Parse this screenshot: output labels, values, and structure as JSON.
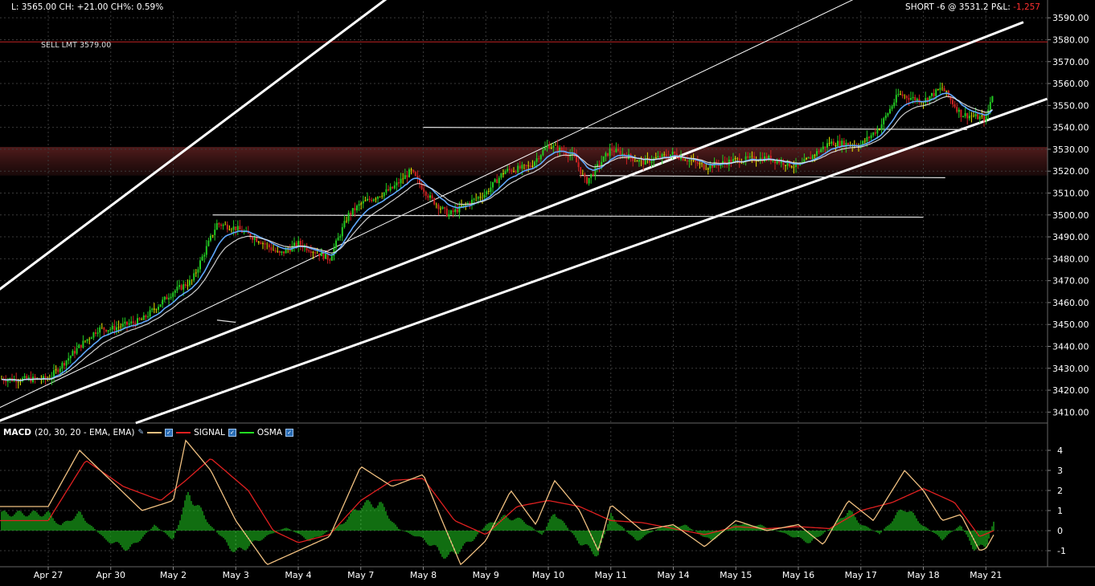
{
  "header": {
    "quote": "L: 3565.00 CH: +21.00 CH%: 0.59%",
    "position": "SHORT -6 @ 3531.2 P&L:",
    "pnl": "-1,257"
  },
  "order": {
    "label": "SELL LMT 3579.00",
    "price": 3579.0
  },
  "colors": {
    "background": "#000000",
    "grid": "#3a3a3a",
    "up_bar": "#22cc22",
    "down_bar": "#cc2222",
    "doji_bar": "#e8e800",
    "ema_fast": "#5fa8ff",
    "ema_slow": "#f0f0f0",
    "channel": "#ffffff",
    "order_line": "#b02020",
    "zone": "#5a1f1f",
    "macd": "#f0c080",
    "signal": "#e02020",
    "osma": "#22dd22"
  },
  "macd_legend": {
    "title": "MACD",
    "params": "(20, 30, 20 - EMA, EMA)",
    "series": [
      {
        "name": "",
        "color": "#f0c080"
      },
      {
        "name": "SIGNAL",
        "color": "#e02020"
      },
      {
        "name": "OSMA",
        "color": "#22dd22"
      }
    ]
  },
  "chart_data": [
    {
      "type": "candlestick",
      "x_labels": [
        "Apr 27",
        "Apr 30",
        "May 2",
        "May 3",
        "May 4",
        "May 7",
        "May 8",
        "May 9",
        "May 10",
        "May 11",
        "May 14",
        "May 15",
        "May 16",
        "May 17",
        "May 18",
        "May 21"
      ],
      "y_ticks": [
        3410,
        3420,
        3430,
        3440,
        3450,
        3460,
        3470,
        3480,
        3490,
        3500,
        3510,
        3520,
        3530,
        3540,
        3550,
        3560,
        3570,
        3580,
        3590
      ],
      "ylim": [
        3405,
        3593
      ],
      "grid": true,
      "price_path": [
        {
          "t": 0.0,
          "y": 3425
        },
        {
          "t": 0.5,
          "y": 3440
        },
        {
          "t": 0.8,
          "y": 3448
        },
        {
          "t": 1.0,
          "y": 3448
        },
        {
          "t": 1.5,
          "y": 3452
        },
        {
          "t": 2.0,
          "y": 3465
        },
        {
          "t": 2.3,
          "y": 3470
        },
        {
          "t": 2.7,
          "y": 3496
        },
        {
          "t": 3.0,
          "y": 3494
        },
        {
          "t": 3.4,
          "y": 3488
        },
        {
          "t": 3.7,
          "y": 3482
        },
        {
          "t": 4.0,
          "y": 3487
        },
        {
          "t": 4.5,
          "y": 3480
        },
        {
          "t": 4.8,
          "y": 3500
        },
        {
          "t": 5.0,
          "y": 3505
        },
        {
          "t": 5.5,
          "y": 3512
        },
        {
          "t": 5.8,
          "y": 3520
        },
        {
          "t": 6.1,
          "y": 3508
        },
        {
          "t": 6.4,
          "y": 3500
        },
        {
          "t": 6.7,
          "y": 3505
        },
        {
          "t": 7.0,
          "y": 3510
        },
        {
          "t": 7.3,
          "y": 3520
        },
        {
          "t": 7.7,
          "y": 3522
        },
        {
          "t": 8.0,
          "y": 3532
        },
        {
          "t": 8.4,
          "y": 3527
        },
        {
          "t": 8.6,
          "y": 3515
        },
        {
          "t": 9.0,
          "y": 3530
        },
        {
          "t": 9.5,
          "y": 3524
        },
        {
          "t": 10.0,
          "y": 3528
        },
        {
          "t": 10.5,
          "y": 3522
        },
        {
          "t": 11.0,
          "y": 3525
        },
        {
          "t": 11.5,
          "y": 3526
        },
        {
          "t": 12.0,
          "y": 3522
        },
        {
          "t": 12.5,
          "y": 3533
        },
        {
          "t": 13.0,
          "y": 3532
        },
        {
          "t": 13.3,
          "y": 3540
        },
        {
          "t": 13.6,
          "y": 3555
        },
        {
          "t": 14.0,
          "y": 3552
        },
        {
          "t": 14.3,
          "y": 3558
        },
        {
          "t": 14.6,
          "y": 3546
        },
        {
          "t": 15.0,
          "y": 3544
        },
        {
          "t": 15.2,
          "y": 3565
        }
      ]
    },
    {
      "type": "line",
      "name": "MACD",
      "y_ticks": [
        -1,
        0,
        1,
        2,
        3,
        4
      ],
      "ylim": [
        -1.8,
        4.6
      ],
      "series": [
        {
          "name": "",
          "points": [
            {
              "t": 0.0,
              "y": 1.2
            },
            {
              "t": 0.5,
              "y": 4.0
            },
            {
              "t": 1.0,
              "y": 2.5
            },
            {
              "t": 1.5,
              "y": 1.0
            },
            {
              "t": 2.0,
              "y": 1.5
            },
            {
              "t": 2.2,
              "y": 4.5
            },
            {
              "t": 2.6,
              "y": 3.0
            },
            {
              "t": 3.0,
              "y": 0.5
            },
            {
              "t": 3.5,
              "y": -1.7
            },
            {
              "t": 4.0,
              "y": -1.0
            },
            {
              "t": 4.5,
              "y": -0.3
            },
            {
              "t": 5.0,
              "y": 3.2
            },
            {
              "t": 5.5,
              "y": 2.2
            },
            {
              "t": 6.0,
              "y": 2.8
            },
            {
              "t": 6.3,
              "y": 0.5
            },
            {
              "t": 6.6,
              "y": -1.7
            },
            {
              "t": 7.0,
              "y": -0.5
            },
            {
              "t": 7.4,
              "y": 2.0
            },
            {
              "t": 7.8,
              "y": 0.3
            },
            {
              "t": 8.1,
              "y": 2.5
            },
            {
              "t": 8.5,
              "y": 1.0
            },
            {
              "t": 8.8,
              "y": -1.0
            },
            {
              "t": 9.0,
              "y": 1.3
            },
            {
              "t": 9.5,
              "y": 0.0
            },
            {
              "t": 10.0,
              "y": 0.3
            },
            {
              "t": 10.5,
              "y": -0.8
            },
            {
              "t": 11.0,
              "y": 0.5
            },
            {
              "t": 11.5,
              "y": 0.0
            },
            {
              "t": 12.0,
              "y": 0.3
            },
            {
              "t": 12.4,
              "y": -0.7
            },
            {
              "t": 12.8,
              "y": 1.5
            },
            {
              "t": 13.2,
              "y": 0.5
            },
            {
              "t": 13.7,
              "y": 3.0
            },
            {
              "t": 14.0,
              "y": 2.0
            },
            {
              "t": 14.3,
              "y": 0.5
            },
            {
              "t": 14.6,
              "y": 0.8
            },
            {
              "t": 14.9,
              "y": -1.0
            },
            {
              "t": 15.0,
              "y": -0.9
            },
            {
              "t": 15.2,
              "y": 0.2
            }
          ]
        },
        {
          "name": "SIGNAL",
          "points": [
            {
              "t": 0.0,
              "y": 0.5
            },
            {
              "t": 0.6,
              "y": 3.5
            },
            {
              "t": 1.2,
              "y": 2.2
            },
            {
              "t": 1.8,
              "y": 1.5
            },
            {
              "t": 2.2,
              "y": 2.5
            },
            {
              "t": 2.6,
              "y": 3.6
            },
            {
              "t": 3.2,
              "y": 2.0
            },
            {
              "t": 3.6,
              "y": 0.0
            },
            {
              "t": 4.0,
              "y": -0.6
            },
            {
              "t": 4.5,
              "y": -0.2
            },
            {
              "t": 5.0,
              "y": 1.5
            },
            {
              "t": 5.5,
              "y": 2.5
            },
            {
              "t": 6.0,
              "y": 2.6
            },
            {
              "t": 6.5,
              "y": 0.5
            },
            {
              "t": 7.0,
              "y": -0.2
            },
            {
              "t": 7.5,
              "y": 1.2
            },
            {
              "t": 8.0,
              "y": 1.5
            },
            {
              "t": 8.5,
              "y": 1.2
            },
            {
              "t": 9.0,
              "y": 0.5
            },
            {
              "t": 9.5,
              "y": 0.4
            },
            {
              "t": 10.0,
              "y": 0.1
            },
            {
              "t": 10.5,
              "y": -0.2
            },
            {
              "t": 11.0,
              "y": 0.2
            },
            {
              "t": 11.5,
              "y": 0.1
            },
            {
              "t": 12.0,
              "y": 0.2
            },
            {
              "t": 12.5,
              "y": 0.1
            },
            {
              "t": 13.0,
              "y": 1.0
            },
            {
              "t": 13.5,
              "y": 1.4
            },
            {
              "t": 14.0,
              "y": 2.1
            },
            {
              "t": 14.5,
              "y": 1.4
            },
            {
              "t": 14.9,
              "y": -0.3
            },
            {
              "t": 15.2,
              "y": 0.1
            }
          ]
        }
      ],
      "osma": [
        {
          "t": 0.0,
          "y": 1.0
        },
        {
          "t": 0.2,
          "y": 0.3
        },
        {
          "t": 0.5,
          "y": 1.0
        },
        {
          "t": 0.9,
          "y": -0.5
        },
        {
          "t": 1.3,
          "y": -1.1
        },
        {
          "t": 1.7,
          "y": 0.3
        },
        {
          "t": 2.0,
          "y": -0.5
        },
        {
          "t": 2.25,
          "y": 2.2
        },
        {
          "t": 2.6,
          "y": 0.3
        },
        {
          "t": 3.0,
          "y": -1.3
        },
        {
          "t": 3.4,
          "y": -0.5
        },
        {
          "t": 3.8,
          "y": 0.2
        },
        {
          "t": 4.2,
          "y": -0.6
        },
        {
          "t": 4.7,
          "y": 0.4
        },
        {
          "t": 5.0,
          "y": 1.5
        },
        {
          "t": 5.3,
          "y": 1.6
        },
        {
          "t": 5.6,
          "y": 0.1
        },
        {
          "t": 6.0,
          "y": -0.5
        },
        {
          "t": 6.4,
          "y": -1.6
        },
        {
          "t": 6.8,
          "y": -0.5
        },
        {
          "t": 7.0,
          "y": 0.3
        },
        {
          "t": 7.3,
          "y": 0.8
        },
        {
          "t": 7.6,
          "y": 0.6
        },
        {
          "t": 7.9,
          "y": -0.3
        },
        {
          "t": 8.1,
          "y": 1.1
        },
        {
          "t": 8.5,
          "y": -0.7
        },
        {
          "t": 8.8,
          "y": -1.4
        },
        {
          "t": 9.0,
          "y": 0.9
        },
        {
          "t": 9.4,
          "y": -0.6
        },
        {
          "t": 9.8,
          "y": 0.2
        },
        {
          "t": 10.2,
          "y": 0.3
        },
        {
          "t": 10.6,
          "y": -0.6
        },
        {
          "t": 11.0,
          "y": 0.4
        },
        {
          "t": 11.4,
          "y": 0.3
        },
        {
          "t": 11.8,
          "y": -0.2
        },
        {
          "t": 12.2,
          "y": -0.7
        },
        {
          "t": 12.6,
          "y": 0.4
        },
        {
          "t": 12.8,
          "y": 1.2
        },
        {
          "t": 13.0,
          "y": 0.4
        },
        {
          "t": 13.3,
          "y": -0.2
        },
        {
          "t": 13.7,
          "y": 1.4
        },
        {
          "t": 14.0,
          "y": 0.3
        },
        {
          "t": 14.3,
          "y": -0.5
        },
        {
          "t": 14.6,
          "y": 0.3
        },
        {
          "t": 14.8,
          "y": -1.0
        },
        {
          "t": 15.0,
          "y": -1.0
        },
        {
          "t": 15.2,
          "y": 1.5
        }
      ]
    }
  ]
}
